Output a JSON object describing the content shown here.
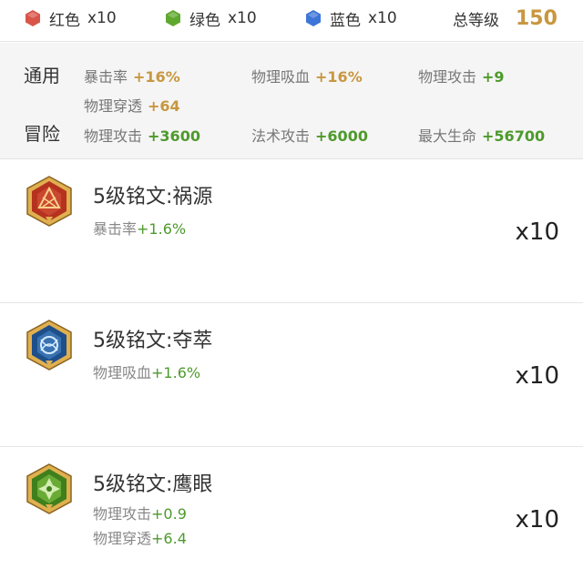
{
  "summary": {
    "gems": [
      {
        "label": "红色",
        "count": "x10",
        "color": "#d9554a"
      },
      {
        "label": "绿色",
        "count": "x10",
        "color": "#5fa82e"
      },
      {
        "label": "蓝色",
        "count": "x10",
        "color": "#3d75d8"
      }
    ],
    "total_label": "总等级",
    "total_value": "150"
  },
  "stats": {
    "general": {
      "label": "通用",
      "items": [
        {
          "name": "暴击率",
          "value": "+16%"
        },
        {
          "name": "物理吸血",
          "value": "+16%"
        },
        {
          "name": "物理攻击",
          "value": "+9"
        },
        {
          "name": "物理穿透",
          "value": "+64"
        }
      ]
    },
    "adventure": {
      "label": "冒险",
      "items": [
        {
          "name": "物理攻击",
          "value": "+3600"
        },
        {
          "name": "法术攻击",
          "value": "+6000"
        },
        {
          "name": "最大生命",
          "value": "+56700"
        }
      ]
    }
  },
  "runes": [
    {
      "name": "5级铭文:祸源",
      "icon": "red-rune-icon",
      "color": "#c8402f",
      "attrs": [
        {
          "name": "暴击率",
          "value": "+1.6%"
        }
      ],
      "count": "x10"
    },
    {
      "name": "5级铭文:夺萃",
      "icon": "blue-rune-icon",
      "color": "#2f6fb8",
      "attrs": [
        {
          "name": "物理吸血",
          "value": "+1.6%"
        }
      ],
      "count": "x10"
    },
    {
      "name": "5级铭文:鹰眼",
      "icon": "green-rune-icon",
      "color": "#5aa52a",
      "attrs": [
        {
          "name": "物理攻击",
          "value": "+0.9"
        },
        {
          "name": "物理穿透",
          "value": "+6.4"
        }
      ],
      "count": "x10"
    }
  ]
}
